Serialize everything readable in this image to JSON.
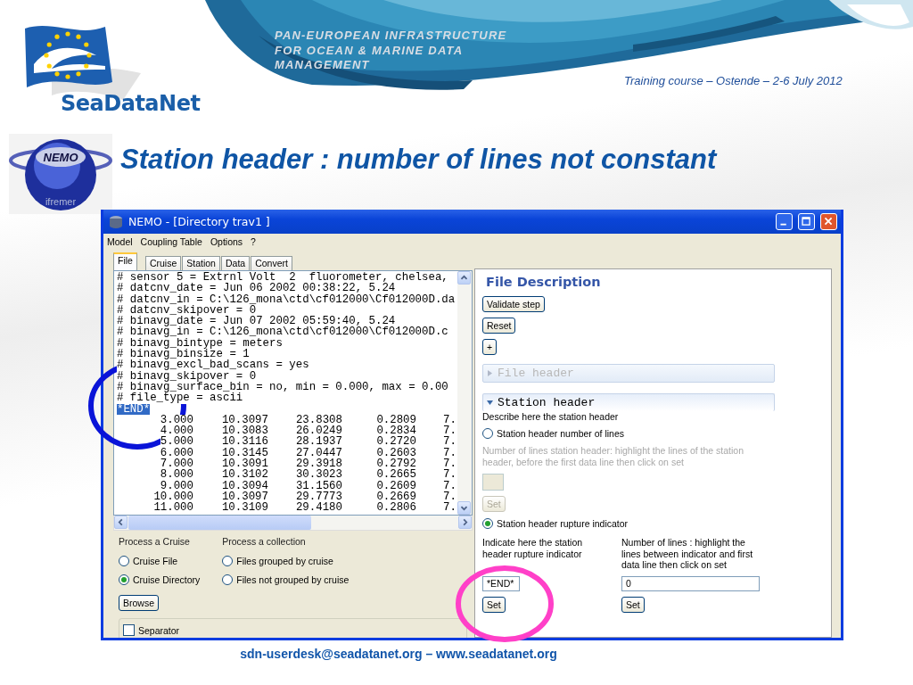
{
  "header": {
    "tagline": [
      "PAN-EUROPEAN INFRASTRUCTURE",
      "FOR OCEAN & MARINE DATA",
      "MANAGEMENT"
    ],
    "logo_text": "SeaDataNet",
    "event": "Training course – Ostende – 2-6 July 2012"
  },
  "nemo_logo": {
    "name": "NEMO",
    "org": "ifremer"
  },
  "slide_title": "Station header : number of lines not constant",
  "window": {
    "title": "NEMO - [Directory trav1 ]",
    "menu": [
      "Model",
      "Coupling Table",
      "Options",
      "?"
    ],
    "tabs": [
      {
        "label": "File",
        "selected": true
      },
      {
        "label": "Cruise",
        "selected": false
      },
      {
        "label": "Station",
        "selected": false
      },
      {
        "label": "Data",
        "selected": false
      },
      {
        "label": "Convert",
        "selected": false
      }
    ],
    "header_lines": [
      {
        "text": "# sensor 5 = Extrnl Volt  2  fluorometer, chelsea,",
        "selected": false
      },
      {
        "text": "# datcnv_date = Jun 06 2002 00:38:22, 5.24",
        "selected": false
      },
      {
        "text": "# datcnv_in = C:\\126_mona\\ctd\\cf012000\\Cf012000D.da",
        "selected": false
      },
      {
        "text": "# datcnv_skipover = 0",
        "selected": false
      },
      {
        "text": "# binavg_date = Jun 07 2002 05:59:40, 5.24",
        "selected": false
      },
      {
        "text": "# binavg_in = C:\\126_mona\\ctd\\cf012000\\Cf012000D.c",
        "selected": false
      },
      {
        "text": "# binavg_bintype = meters",
        "selected": false
      },
      {
        "text": "# binavg_binsize = 1",
        "selected": false
      },
      {
        "text": "# binavg_excl_bad_scans = yes",
        "selected": false
      },
      {
        "text": "# binavg_skipover = 0",
        "selected": false
      },
      {
        "text": "# binavg_surface_bin = no, min = 0.000, max = 0.00",
        "selected": false
      },
      {
        "text": "# file_type = ascii",
        "selected": false
      },
      {
        "text": "*END*",
        "selected": true
      }
    ],
    "data_rows": [
      [
        "3.000",
        "10.3097",
        "23.8308",
        "0.2809",
        "7."
      ],
      [
        "4.000",
        "10.3083",
        "26.0249",
        "0.2834",
        "7."
      ],
      [
        "5.000",
        "10.3116",
        "28.1937",
        "0.2720",
        "7."
      ],
      [
        "6.000",
        "10.3145",
        "27.0447",
        "0.2603",
        "7."
      ],
      [
        "7.000",
        "10.3091",
        "29.3918",
        "0.2792",
        "7."
      ],
      [
        "8.000",
        "10.3102",
        "30.3023",
        "0.2665",
        "7."
      ],
      [
        "9.000",
        "10.3094",
        "31.1560",
        "0.2609",
        "7."
      ],
      [
        "10.000",
        "10.3097",
        "29.7773",
        "0.2669",
        "7."
      ],
      [
        "11.000",
        "10.3109",
        "29.4180",
        "0.2806",
        "7."
      ]
    ],
    "process_cruise": {
      "label": "Process a Cruise",
      "options": [
        {
          "label": "Cruise File",
          "selected": false
        },
        {
          "label": "Cruise Directory",
          "selected": true
        }
      ]
    },
    "process_collection": {
      "label": "Process a collection",
      "options": [
        {
          "label": "Files grouped by cruise",
          "selected": false
        },
        {
          "label": "Files not grouped by cruise",
          "selected": false
        }
      ]
    },
    "browse_button": "Browse",
    "separator": {
      "label": "Separator",
      "checked": false
    },
    "file_description": {
      "title": "File Description",
      "validate_button": "Validate step",
      "reset_button": "Reset",
      "plus_button": "+",
      "sections": [
        {
          "label": "File header",
          "expanded": false,
          "disabled": true
        },
        {
          "label": "Station header",
          "expanded": true,
          "disabled": false
        }
      ],
      "description": "Describe here the station header",
      "lines_option": {
        "label": "Station header number of lines",
        "selected": false
      },
      "lines_hint": "Number of lines station header: highlight the lines of the station header, before the first data line then click on set",
      "lines_set": {
        "label": "Set",
        "disabled": true
      },
      "indicator_option": {
        "label": "Station header rupture indicator",
        "selected": true
      },
      "indicator_hint": "Indicate here the station header rupture indicator",
      "indicator_value": "*END*",
      "indicator_set": {
        "label": "Set",
        "disabled": false
      },
      "count_hint": "Number of lines : highlight the lines between indicator and first data line then click on set",
      "count_value": "0",
      "count_set": {
        "label": "Set",
        "disabled": false
      }
    }
  },
  "footer": "sdn-userdesk@seadatanet.org – www.seadatanet.org"
}
